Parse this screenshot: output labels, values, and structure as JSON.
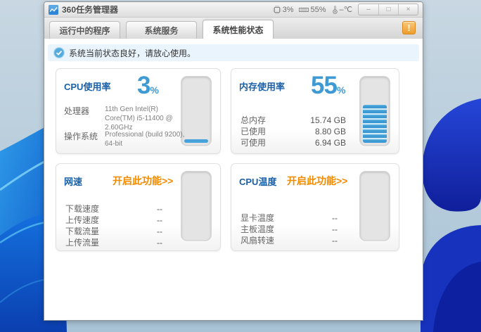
{
  "window": {
    "title": "360任务管理器",
    "titlebar_status": {
      "cpu_percent": "3%",
      "mem_percent": "55%",
      "temperature": "–℃"
    },
    "controls": {
      "minimize": "–",
      "maximize": "□",
      "close": "×"
    }
  },
  "tabs": [
    {
      "label": "运行中的程序",
      "active": false
    },
    {
      "label": "系统服务",
      "active": false
    },
    {
      "label": "系统性能状态",
      "active": true
    }
  ],
  "alert_button_label": "!",
  "status_message": "系统当前状态良好，请放心使用。",
  "panels": {
    "cpu": {
      "title": "CPU使用率",
      "value": "3",
      "unit": "%",
      "gauge_percent": 5,
      "rows": [
        {
          "label": "处理器",
          "value": "11th Gen Intel(R) Core(TM) i5-11400 @ 2.60GHz"
        },
        {
          "label": "操作系统",
          "value": "Professional (build 9200), 64-bit"
        }
      ]
    },
    "memory": {
      "title": "内存使用率",
      "value": "55",
      "unit": "%",
      "gauge_percent": 55,
      "rows": [
        {
          "label": "总内存",
          "value": "15.74 GB"
        },
        {
          "label": "已使用",
          "value": "8.80 GB"
        },
        {
          "label": "可使用",
          "value": "6.94 GB"
        }
      ]
    },
    "network": {
      "title": "网速",
      "action": "开启此功能>>",
      "gauge_percent": 0,
      "rows": [
        {
          "label": "下载速度",
          "value": "--"
        },
        {
          "label": "上传速度",
          "value": "--"
        },
        {
          "label": "下载流量",
          "value": "--"
        },
        {
          "label": "上传流量",
          "value": "--"
        }
      ]
    },
    "temperature": {
      "title": "CPU温度",
      "action": "开启此功能>>",
      "gauge_percent": 0,
      "rows": [
        {
          "label": "显卡温度",
          "value": "--"
        },
        {
          "label": "主板温度",
          "value": "--"
        },
        {
          "label": "风扇转速",
          "value": "--"
        }
      ]
    }
  },
  "colors": {
    "accent_blue": "#1b5fa6",
    "value_blue": "#3f9ad3",
    "gauge_blue": "#46a2da",
    "action_orange": "#f28a00",
    "statusbar_bg": "#e9f4fc"
  }
}
